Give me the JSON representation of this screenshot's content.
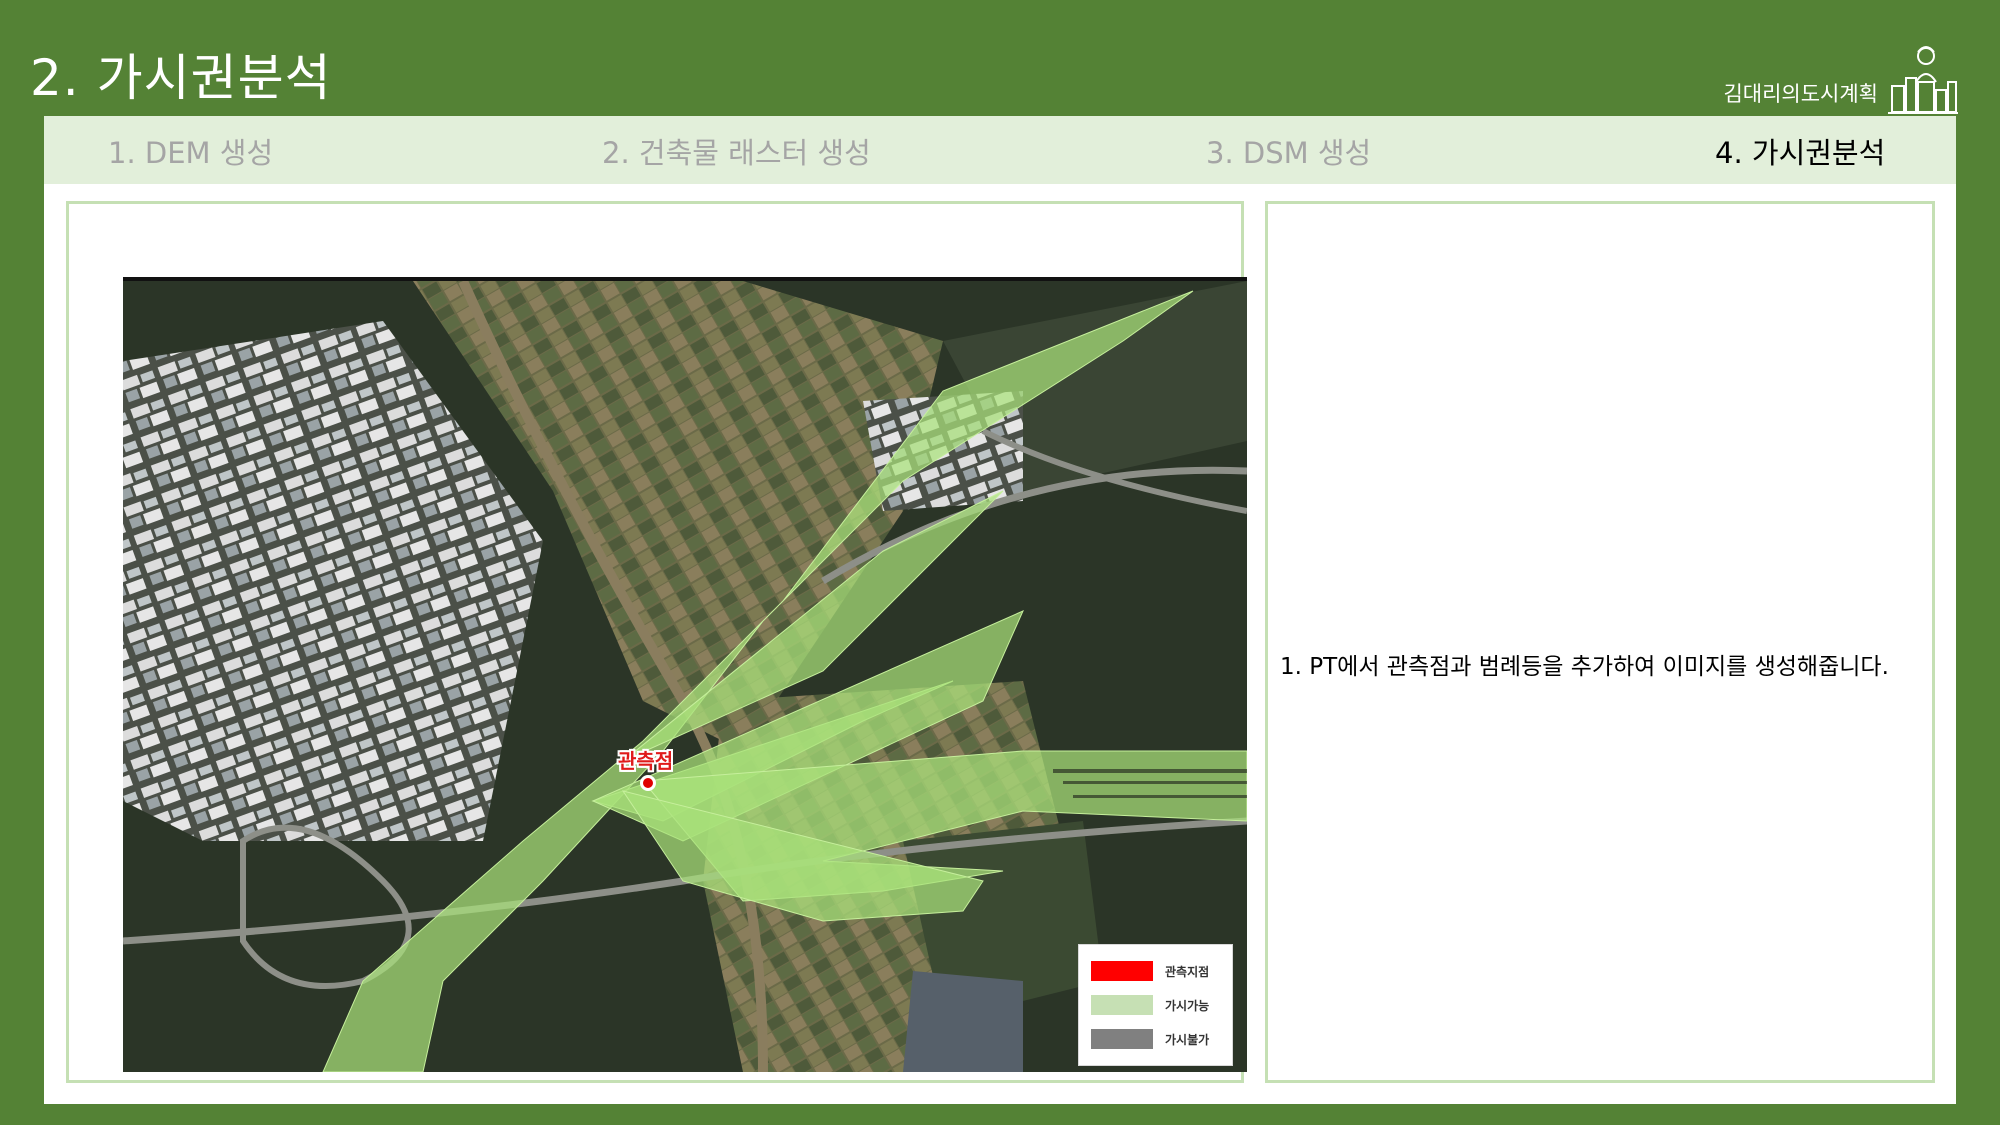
{
  "slide": {
    "title": "2. 가시권분석"
  },
  "brand": {
    "text": "김대리의도시계획",
    "logo_icon": "city-planner-logo-icon"
  },
  "tabs": [
    {
      "label": "1. DEM 생성",
      "active": false
    },
    {
      "label": "2. 건축물 래스터 생성",
      "active": false
    },
    {
      "label": "3. DSM 생성",
      "active": false
    },
    {
      "label": "4. 가시권분석",
      "active": true
    }
  ],
  "map": {
    "observation_point_label": "관측점",
    "legend": [
      {
        "label": "관측지점",
        "color": "#ff0000"
      },
      {
        "label": "가시가능",
        "color": "#c6e0b4"
      },
      {
        "label": "가시불가",
        "color": "#808080"
      }
    ]
  },
  "description": "1. PT에서 관측점과 범례등을 추가하여 이미지를 생성해줍니다.",
  "colors": {
    "background": "#548235",
    "tab_bar": "#e2efda",
    "panel_border": "#c5e0b4",
    "visible_area": "#a9e27a"
  }
}
